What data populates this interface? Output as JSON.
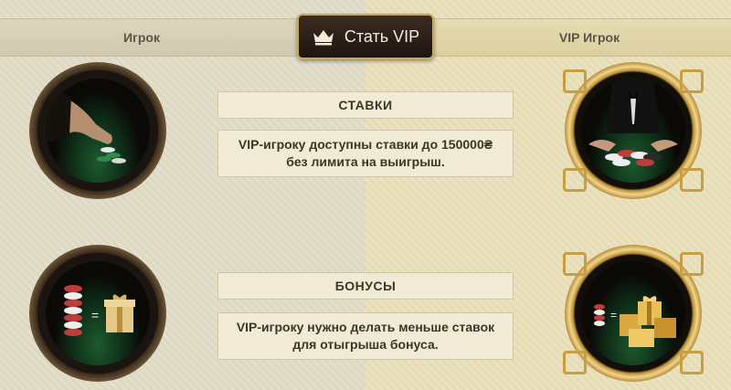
{
  "tabs": {
    "player": "Игрок",
    "vip_player": "VIP Игрок"
  },
  "cta": {
    "label": "Стать VIP",
    "icon": "crown-icon"
  },
  "sections": [
    {
      "title": "СТАВКИ",
      "text": "VIP-игроку доступны ставки до 150000₴ без лимита на выигрыш."
    },
    {
      "title": "БОНУСЫ",
      "text": "VIP-игроку нужно делать меньше ставок для отыгрыша бонуса."
    }
  ],
  "equals_sign": "=",
  "colors": {
    "accent_gold": "#c9a85a",
    "button_dark": "#2a1f17",
    "felt_green": "#1c5a2d"
  }
}
